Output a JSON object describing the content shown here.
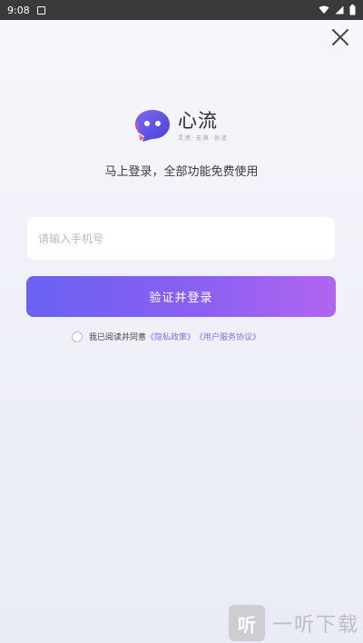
{
  "status_bar": {
    "time": "9:08"
  },
  "logo": {
    "name": "心流",
    "subtitle": "灵感·无限·创造"
  },
  "tagline": "马上登录，全部功能免费使用",
  "phone_input": {
    "placeholder": "请输入手机号",
    "value": ""
  },
  "login_button": {
    "label": "验证并登录"
  },
  "agreement": {
    "prefix": "我已阅读并同意",
    "privacy_link": "《隐私政策》",
    "terms_link": "《用户服务协议》"
  },
  "watermark": {
    "badge": "听",
    "text": "一听下载"
  },
  "colors": {
    "accent_start": "#6a61f2",
    "accent_end": "#b065ef",
    "link": "#8a6cf0"
  },
  "icons": [
    "wifi-icon",
    "signal-icon",
    "battery-icon",
    "close-icon",
    "logo-icon"
  ]
}
